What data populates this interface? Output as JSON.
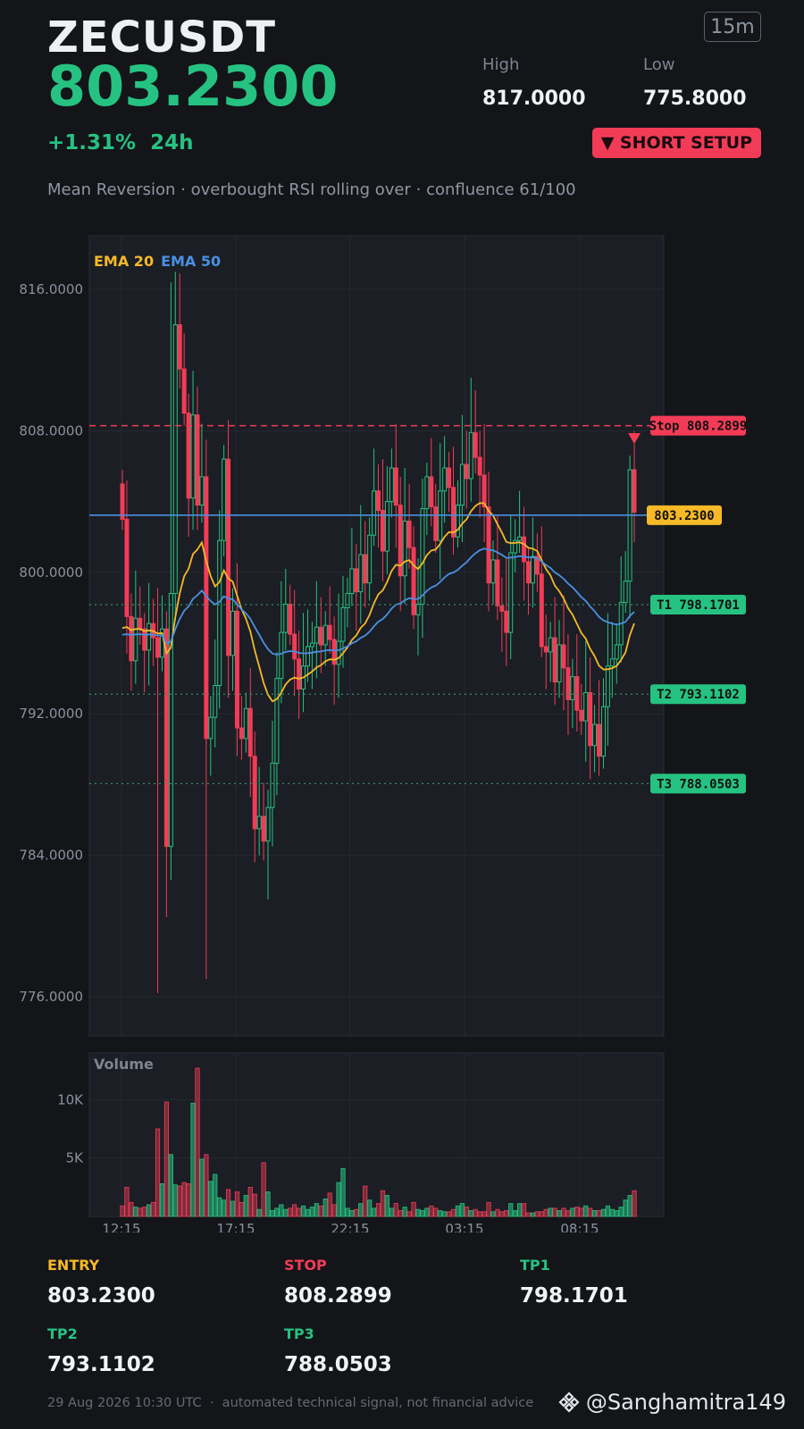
{
  "header": {
    "symbol": "ZECUSDT",
    "price": "803.2300",
    "timeframe": "15m",
    "high_label": "High",
    "high_value": "817.0000",
    "low_label": "Low",
    "low_value": "775.8000",
    "change": "+1.31%  24h",
    "setup_badge": "▼ SHORT SETUP",
    "subtitle": "Mean Reversion · overbought RSI rolling over · confluence 61/100"
  },
  "colors": {
    "background": "#131519",
    "panel": "#1b1e24",
    "bull": "#26c281",
    "bear": "#f23c57",
    "ema20": "#f7b928",
    "ema50": "#4a90e2",
    "entry": "#f7b928",
    "stop": "#f23c57",
    "target": "#26c281"
  },
  "chart_data": {
    "type": "candlestick",
    "symbol": "ZECUSDT",
    "interval": "15m",
    "y_ticks": [
      "816.0000",
      "808.0000",
      "800.0000",
      "792.0000",
      "784.0000",
      "776.0000"
    ],
    "ylim": [
      773,
      819
    ],
    "x_ticks": [
      "12:15",
      "17:15",
      "22:15",
      "03:15",
      "08:15"
    ],
    "legend": [
      "EMA 20",
      "EMA 50"
    ],
    "close_start": 803.0,
    "candle_closes": [
      803.0,
      797.5,
      795.0,
      797.4,
      796.8,
      795.6,
      797.1,
      796.3,
      795.2,
      796.8,
      784.5,
      798.8,
      814.0,
      811.5,
      809.0,
      804.2,
      808.9,
      803.8,
      805.4,
      790.6,
      791.8,
      793.6,
      801.8,
      806.4,
      795.3,
      797.8,
      791.2,
      790.6,
      792.3,
      789.6,
      785.5,
      786.2,
      784.8,
      786.7,
      789.2,
      794.0,
      796.6,
      798.2,
      796.5,
      795.1,
      793.4,
      794.7,
      795.8,
      796.0,
      796.9,
      795.9,
      797.0,
      796.2,
      794.8,
      796.1,
      798.0,
      798.8,
      800.2,
      798.9,
      801.0,
      799.4,
      802.1,
      804.6,
      803.5,
      801.2,
      804.0,
      805.9,
      803.8,
      799.8,
      802.9,
      801.4,
      797.6,
      798.2,
      803.6,
      805.4,
      803.7,
      801.8,
      804.6,
      805.9,
      804.8,
      802.0,
      803.8,
      806.1,
      805.3,
      807.9,
      806.5,
      805.5,
      803.7,
      799.4,
      800.7,
      798.1,
      797.8,
      796.6,
      801.1,
      801.8,
      802.0,
      800.6,
      799.4,
      800.9,
      799.9,
      795.8,
      795.5,
      796.3,
      793.8,
      795.9,
      794.6,
      792.8,
      794.1,
      792.2,
      791.6,
      793.2,
      790.2,
      791.4,
      789.6,
      792.4,
      794.7,
      795.1,
      795.9,
      798.3,
      799.5,
      805.8,
      803.4
    ],
    "ema20_last": 797.5,
    "ema50_last": 798.1,
    "levels": [
      {
        "name": "Stop",
        "value": 808.2899,
        "label": "Stop 808.2899",
        "style": "dashed"
      },
      {
        "name": "Entry",
        "value": 803.23,
        "label": "803.2300",
        "style": "solid"
      },
      {
        "name": "T1",
        "value": 798.1701,
        "label": "T1 798.1701",
        "style": "dotted"
      },
      {
        "name": "T2",
        "value": 793.1102,
        "label": "T2 793.1102",
        "style": "dotted"
      },
      {
        "name": "T3",
        "value": 788.0503,
        "label": "T3 788.0503",
        "style": "dotted"
      }
    ],
    "volume": {
      "title": "Volume",
      "y_ticks": [
        "10K",
        "5K"
      ],
      "ylim": [
        0,
        14000
      ],
      "values": [
        900,
        2500,
        1200,
        800,
        700,
        800,
        1000,
        1200,
        7500,
        2800,
        9800,
        5300,
        2700,
        2600,
        2900,
        2800,
        9700,
        12700,
        4900,
        5300,
        3000,
        3600,
        1600,
        1400,
        2300,
        1300,
        2100,
        1200,
        1800,
        2500,
        1900,
        600,
        4600,
        2100,
        500,
        700,
        1000,
        600,
        700,
        1000,
        700,
        900,
        600,
        800,
        1100,
        900,
        1500,
        2000,
        1000,
        2900,
        4100,
        700,
        500,
        600,
        1100,
        2600,
        1400,
        700,
        1100,
        2200,
        1800,
        700,
        1100,
        500,
        800,
        400,
        1200,
        600,
        500,
        700,
        900,
        700,
        500,
        400,
        400,
        600,
        900,
        1100,
        800,
        500,
        600,
        400,
        400,
        1200,
        400,
        600,
        400,
        500,
        1100,
        500,
        1100,
        1100,
        300,
        300,
        400,
        400,
        600,
        700,
        700,
        500,
        700,
        500,
        700,
        800,
        700,
        900,
        700,
        500,
        500,
        600,
        900,
        600,
        500,
        800,
        1400,
        1800,
        2200,
        700,
        600
      ]
    }
  },
  "levels_panel": [
    {
      "label": "ENTRY",
      "value": "803.2300",
      "color": "#f7b928"
    },
    {
      "label": "STOP",
      "value": "808.2899",
      "color": "#f23c57"
    },
    {
      "label": "TP1",
      "value": "798.1701",
      "color": "#26c281"
    },
    {
      "label": "TP2",
      "value": "793.1102",
      "color": "#26c281"
    },
    {
      "label": "TP3",
      "value": "788.0503",
      "color": "#26c281"
    }
  ],
  "footer": {
    "text": "29 Aug 2026 10:30 UTC  ·  automated technical signal, not financial advice",
    "handle": "@Sanghamitra149",
    "logo_icon": "binance-logo-icon"
  }
}
